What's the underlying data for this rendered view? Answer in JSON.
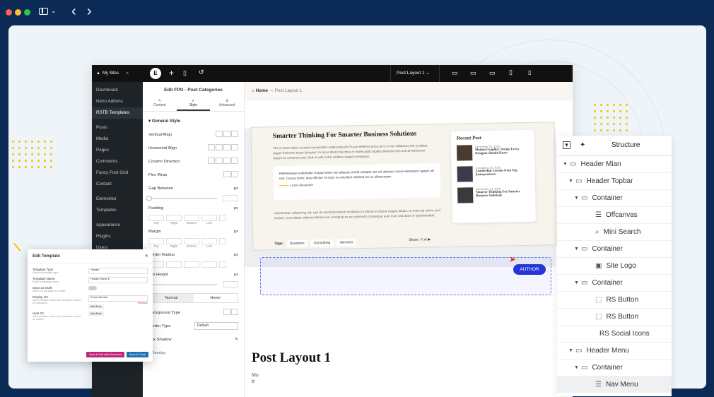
{
  "window_nav": {
    "sidebar_icon": "sidebar-icon",
    "back": "‹",
    "forward": "›"
  },
  "wp": {
    "site": "My Sites",
    "menu": [
      "Dashboard",
      "Nerio Addons",
      "RSTB Templates",
      "Posts",
      "Media",
      "Pages",
      "Comments",
      "Fancy Post Grid",
      "Contact",
      "Elementor",
      "Templates",
      "Appearance",
      "Plugins",
      "Users"
    ]
  },
  "toolbar": {
    "layout_select": "Post Layout 1"
  },
  "panel": {
    "title": "Edit FPG - Post Categories",
    "tabs": [
      "Content",
      "Style",
      "Advanced"
    ],
    "section": "General Style",
    "rows": [
      "Vertical Align",
      "Horizontal Align",
      "Column Direction",
      "Flex Wrap",
      "Gap Between",
      "Padding",
      "Margin",
      "Border Radius",
      "Min Height"
    ],
    "unit": "px",
    "box_labels": [
      "Top",
      "Right",
      "Bottom",
      "Left"
    ],
    "state_tabs": [
      "Normal",
      "Hover"
    ],
    "bg_type": "Background Type",
    "border_type": "Border Type",
    "border_value": "Default",
    "box_shadow": "Box Shadow",
    "overlay": "Overlay"
  },
  "canvas": {
    "breadcrumb_home": "Home",
    "breadcrumb_current": "Post Layout 1",
    "post_title": "Smarter Thinking For Smarter Business Solutions",
    "post_body": "The is lorem dolor sit amet consectetur adipiscing elit. Fusce eleifend porta arcu in hac habitasse the is platea augue thelorem turpis dictumst. In lacus libero faucibus at malesuada sagittis placerat eros sed at elementor augue ac rumorem sed. Sed et velit is the sodales augue consequat.",
    "quote": "Pellentesque sollicitudin congue dolor non aliquam morbi volutpat nisi vel ultricies cmcon elementor sapien vel sed. Cursus tortor, quis efficitur mi nunc eu tincidunt eleifend orci ui ullamcorper.",
    "quote_author": "Leslie Alexander",
    "post_body2": "Consectetur adipiscing elit, sed do eiusmod tempor incididunt ut labore et dolore magna aliqua. Ut enim ad minim sunt veniam, exercitation ullamco laboris nisi ut aliquip ex ea commodo consequat aute irure sed dolor in reprehenderit.",
    "tags_label": "Tags:",
    "tags": [
      "Business",
      "Consulting",
      "Services"
    ],
    "share_label": "Share:",
    "recent_title": "Recent Post",
    "recent": [
      {
        "date": "December 23, 2025",
        "title": "Motion Graphics Trends Every Designer Should Know"
      },
      {
        "date": "Consulting 23, 2025",
        "title": "Leadership Lessons from Top Entrepreneurs"
      },
      {
        "date": "December 23, 2025",
        "title": "Smarter Thinking For Smarter Business Solutions"
      }
    ],
    "author_badge": "AUTHOR",
    "heading": "Post Layout 1",
    "meta1": "Mo",
    "meta2": "tt"
  },
  "modal": {
    "title": "Edit Template",
    "close": "×",
    "fields": [
      {
        "label": "Template Type",
        "help": "Select a template type",
        "value": "Header"
      },
      {
        "label": "Template Name",
        "help": "Enter a template name",
        "value": "Header Home 6"
      },
      {
        "label": "Save as Draft",
        "help": "Save the template as a draft",
        "value": ""
      },
      {
        "label": "Display On",
        "help": "Add a location where the template should be displayed",
        "value": "Entire Website"
      },
      {
        "label": "Hide On",
        "help": "Add a location where the template should be hidden",
        "value": ""
      }
    ],
    "add_rule": "Add Rule",
    "remove": "Remove",
    "save_button": "Save & Edit with Elementor",
    "close_button": "Save & Close"
  },
  "structure": {
    "title": "Structure",
    "items": [
      {
        "label": "Header Mian",
        "depth": 0,
        "type": "container",
        "caret": true
      },
      {
        "label": "Header Topbar",
        "depth": 1,
        "type": "container",
        "caret": true
      },
      {
        "label": "Container",
        "depth": 2,
        "type": "container",
        "caret": true
      },
      {
        "label": "Offcanvas",
        "depth": 3,
        "type": "menu",
        "caret": false
      },
      {
        "label": "Mini Search",
        "depth": 3,
        "type": "search",
        "caret": false
      },
      {
        "label": "Container",
        "depth": 2,
        "type": "container",
        "caret": true
      },
      {
        "label": "Site Logo",
        "depth": 3,
        "type": "image",
        "caret": false
      },
      {
        "label": "Container",
        "depth": 2,
        "type": "container",
        "caret": true
      },
      {
        "label": "RS Button",
        "depth": 3,
        "type": "button",
        "caret": false
      },
      {
        "label": "RS Button",
        "depth": 3,
        "type": "button",
        "caret": false
      },
      {
        "label": "RS Social Icons",
        "depth": 3,
        "type": "none",
        "caret": false
      },
      {
        "label": "Header Menu",
        "depth": 1,
        "type": "container",
        "caret": true
      },
      {
        "label": "Container",
        "depth": 2,
        "type": "container",
        "caret": true
      },
      {
        "label": "Nav Menu",
        "depth": 3,
        "type": "menu",
        "caret": false
      }
    ]
  },
  "colors": {
    "frame": "#0b2a55",
    "accent": "#2636d8",
    "wp_dark": "#1d2327",
    "pink": "#c0267c",
    "blue": "#2271b1",
    "yellow": "#f5c400"
  }
}
